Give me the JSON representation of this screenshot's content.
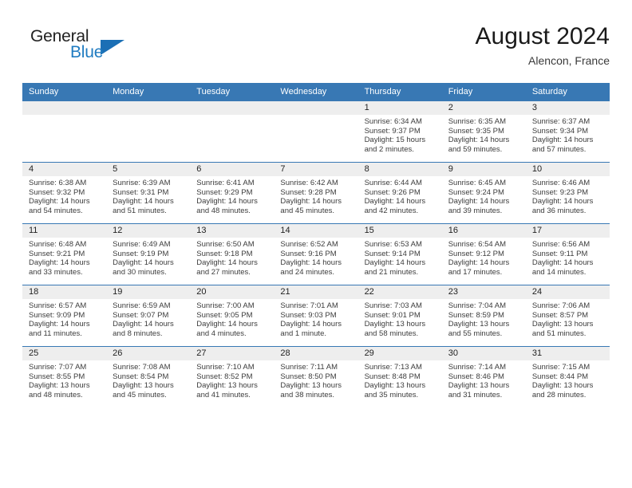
{
  "brand": {
    "line1": "General",
    "line2": "Blue",
    "logo_icon": "triangle-icon",
    "accent_color": "#1b6fb5"
  },
  "header": {
    "title": "August 2024",
    "location": "Alencon, France"
  },
  "calendar": {
    "header_bg": "#3878b4",
    "daynum_bg": "#eeeeee",
    "weekdays": [
      "Sunday",
      "Monday",
      "Tuesday",
      "Wednesday",
      "Thursday",
      "Friday",
      "Saturday"
    ],
    "weeks": [
      [
        {
          "day": "",
          "sunrise": "",
          "sunset": "",
          "daylight_line1": "",
          "daylight_line2": ""
        },
        {
          "day": "",
          "sunrise": "",
          "sunset": "",
          "daylight_line1": "",
          "daylight_line2": ""
        },
        {
          "day": "",
          "sunrise": "",
          "sunset": "",
          "daylight_line1": "",
          "daylight_line2": ""
        },
        {
          "day": "",
          "sunrise": "",
          "sunset": "",
          "daylight_line1": "",
          "daylight_line2": ""
        },
        {
          "day": "1",
          "sunrise": "Sunrise: 6:34 AM",
          "sunset": "Sunset: 9:37 PM",
          "daylight_line1": "Daylight: 15 hours",
          "daylight_line2": "and 2 minutes."
        },
        {
          "day": "2",
          "sunrise": "Sunrise: 6:35 AM",
          "sunset": "Sunset: 9:35 PM",
          "daylight_line1": "Daylight: 14 hours",
          "daylight_line2": "and 59 minutes."
        },
        {
          "day": "3",
          "sunrise": "Sunrise: 6:37 AM",
          "sunset": "Sunset: 9:34 PM",
          "daylight_line1": "Daylight: 14 hours",
          "daylight_line2": "and 57 minutes."
        }
      ],
      [
        {
          "day": "4",
          "sunrise": "Sunrise: 6:38 AM",
          "sunset": "Sunset: 9:32 PM",
          "daylight_line1": "Daylight: 14 hours",
          "daylight_line2": "and 54 minutes."
        },
        {
          "day": "5",
          "sunrise": "Sunrise: 6:39 AM",
          "sunset": "Sunset: 9:31 PM",
          "daylight_line1": "Daylight: 14 hours",
          "daylight_line2": "and 51 minutes."
        },
        {
          "day": "6",
          "sunrise": "Sunrise: 6:41 AM",
          "sunset": "Sunset: 9:29 PM",
          "daylight_line1": "Daylight: 14 hours",
          "daylight_line2": "and 48 minutes."
        },
        {
          "day": "7",
          "sunrise": "Sunrise: 6:42 AM",
          "sunset": "Sunset: 9:28 PM",
          "daylight_line1": "Daylight: 14 hours",
          "daylight_line2": "and 45 minutes."
        },
        {
          "day": "8",
          "sunrise": "Sunrise: 6:44 AM",
          "sunset": "Sunset: 9:26 PM",
          "daylight_line1": "Daylight: 14 hours",
          "daylight_line2": "and 42 minutes."
        },
        {
          "day": "9",
          "sunrise": "Sunrise: 6:45 AM",
          "sunset": "Sunset: 9:24 PM",
          "daylight_line1": "Daylight: 14 hours",
          "daylight_line2": "and 39 minutes."
        },
        {
          "day": "10",
          "sunrise": "Sunrise: 6:46 AM",
          "sunset": "Sunset: 9:23 PM",
          "daylight_line1": "Daylight: 14 hours",
          "daylight_line2": "and 36 minutes."
        }
      ],
      [
        {
          "day": "11",
          "sunrise": "Sunrise: 6:48 AM",
          "sunset": "Sunset: 9:21 PM",
          "daylight_line1": "Daylight: 14 hours",
          "daylight_line2": "and 33 minutes."
        },
        {
          "day": "12",
          "sunrise": "Sunrise: 6:49 AM",
          "sunset": "Sunset: 9:19 PM",
          "daylight_line1": "Daylight: 14 hours",
          "daylight_line2": "and 30 minutes."
        },
        {
          "day": "13",
          "sunrise": "Sunrise: 6:50 AM",
          "sunset": "Sunset: 9:18 PM",
          "daylight_line1": "Daylight: 14 hours",
          "daylight_line2": "and 27 minutes."
        },
        {
          "day": "14",
          "sunrise": "Sunrise: 6:52 AM",
          "sunset": "Sunset: 9:16 PM",
          "daylight_line1": "Daylight: 14 hours",
          "daylight_line2": "and 24 minutes."
        },
        {
          "day": "15",
          "sunrise": "Sunrise: 6:53 AM",
          "sunset": "Sunset: 9:14 PM",
          "daylight_line1": "Daylight: 14 hours",
          "daylight_line2": "and 21 minutes."
        },
        {
          "day": "16",
          "sunrise": "Sunrise: 6:54 AM",
          "sunset": "Sunset: 9:12 PM",
          "daylight_line1": "Daylight: 14 hours",
          "daylight_line2": "and 17 minutes."
        },
        {
          "day": "17",
          "sunrise": "Sunrise: 6:56 AM",
          "sunset": "Sunset: 9:11 PM",
          "daylight_line1": "Daylight: 14 hours",
          "daylight_line2": "and 14 minutes."
        }
      ],
      [
        {
          "day": "18",
          "sunrise": "Sunrise: 6:57 AM",
          "sunset": "Sunset: 9:09 PM",
          "daylight_line1": "Daylight: 14 hours",
          "daylight_line2": "and 11 minutes."
        },
        {
          "day": "19",
          "sunrise": "Sunrise: 6:59 AM",
          "sunset": "Sunset: 9:07 PM",
          "daylight_line1": "Daylight: 14 hours",
          "daylight_line2": "and 8 minutes."
        },
        {
          "day": "20",
          "sunrise": "Sunrise: 7:00 AM",
          "sunset": "Sunset: 9:05 PM",
          "daylight_line1": "Daylight: 14 hours",
          "daylight_line2": "and 4 minutes."
        },
        {
          "day": "21",
          "sunrise": "Sunrise: 7:01 AM",
          "sunset": "Sunset: 9:03 PM",
          "daylight_line1": "Daylight: 14 hours",
          "daylight_line2": "and 1 minute."
        },
        {
          "day": "22",
          "sunrise": "Sunrise: 7:03 AM",
          "sunset": "Sunset: 9:01 PM",
          "daylight_line1": "Daylight: 13 hours",
          "daylight_line2": "and 58 minutes."
        },
        {
          "day": "23",
          "sunrise": "Sunrise: 7:04 AM",
          "sunset": "Sunset: 8:59 PM",
          "daylight_line1": "Daylight: 13 hours",
          "daylight_line2": "and 55 minutes."
        },
        {
          "day": "24",
          "sunrise": "Sunrise: 7:06 AM",
          "sunset": "Sunset: 8:57 PM",
          "daylight_line1": "Daylight: 13 hours",
          "daylight_line2": "and 51 minutes."
        }
      ],
      [
        {
          "day": "25",
          "sunrise": "Sunrise: 7:07 AM",
          "sunset": "Sunset: 8:55 PM",
          "daylight_line1": "Daylight: 13 hours",
          "daylight_line2": "and 48 minutes."
        },
        {
          "day": "26",
          "sunrise": "Sunrise: 7:08 AM",
          "sunset": "Sunset: 8:54 PM",
          "daylight_line1": "Daylight: 13 hours",
          "daylight_line2": "and 45 minutes."
        },
        {
          "day": "27",
          "sunrise": "Sunrise: 7:10 AM",
          "sunset": "Sunset: 8:52 PM",
          "daylight_line1": "Daylight: 13 hours",
          "daylight_line2": "and 41 minutes."
        },
        {
          "day": "28",
          "sunrise": "Sunrise: 7:11 AM",
          "sunset": "Sunset: 8:50 PM",
          "daylight_line1": "Daylight: 13 hours",
          "daylight_line2": "and 38 minutes."
        },
        {
          "day": "29",
          "sunrise": "Sunrise: 7:13 AM",
          "sunset": "Sunset: 8:48 PM",
          "daylight_line1": "Daylight: 13 hours",
          "daylight_line2": "and 35 minutes."
        },
        {
          "day": "30",
          "sunrise": "Sunrise: 7:14 AM",
          "sunset": "Sunset: 8:46 PM",
          "daylight_line1": "Daylight: 13 hours",
          "daylight_line2": "and 31 minutes."
        },
        {
          "day": "31",
          "sunrise": "Sunrise: 7:15 AM",
          "sunset": "Sunset: 8:44 PM",
          "daylight_line1": "Daylight: 13 hours",
          "daylight_line2": "and 28 minutes."
        }
      ]
    ]
  }
}
